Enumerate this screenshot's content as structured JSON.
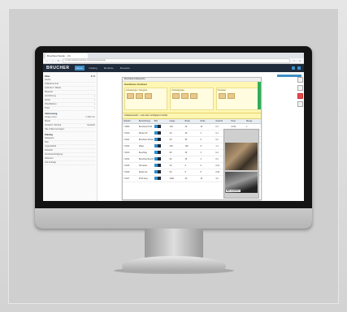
{
  "browser": {
    "tab_title": "Bruchfest Studio · Ch",
    "url": "⊕ http://www.bruchfest.ch/service/startseite"
  },
  "app": {
    "logo": "BRUCHER",
    "menu": [
      "Home",
      "Katalog",
      "Merkliste",
      "Bestellen"
    ],
    "active_menu": 0
  },
  "sidebar": {
    "sections": [
      {
        "title": "Filter",
        "count": "3 / 5",
        "items": [
          {
            "label": "Suche",
            "value": ""
          },
          {
            "label": "Artikelnummer",
            "value": ""
          },
          {
            "label": "Lieferant / Marke",
            "value": ""
          },
          {
            "label": "Material",
            "value": ""
          },
          {
            "label": "Ausführung",
            "value": "›"
          },
          {
            "label": "Farbe",
            "value": "›"
          },
          {
            "label": "Oberflächen",
            "value": "›"
          },
          {
            "label": "Preis",
            "value": "›"
          }
        ]
      },
      {
        "title": "Abmessung",
        "count": "",
        "items": [
          {
            "label": "Länge (mm)",
            "value": "≥ 100 mm"
          },
          {
            "label": "Breite",
            "value": ""
          },
          {
            "label": "Gewicht / Einheit",
            "value": "Gewicht"
          },
          {
            "label": "Alle Artikel anzeigen",
            "value": ""
          }
        ]
      },
      {
        "title": "Katalog",
        "count": "",
        "items": [
          {
            "label": "Kategorie",
            "value": ""
          },
          {
            "label": "Neu",
            "value": ""
          },
          {
            "label": "Lagerartikel",
            "value": ""
          },
          {
            "label": "Zubehör",
            "value": ""
          },
          {
            "label": "Sonderanfertigung",
            "value": ""
          },
          {
            "label": "Aktionen",
            "value": ""
          },
          {
            "label": "Auf Anfrage",
            "value": ""
          }
        ]
      }
    ]
  },
  "panel": {
    "title": "Bruchfest Artikelsuche",
    "top_banner": "Bruchfestes Sortiment",
    "columns": [
      {
        "title": "Artikelgruppe / Kategorie",
        "items": [
          "Profile",
          "Beschläge",
          "Platten"
        ]
      },
      {
        "title": "Produktgruppe",
        "items": [
          "Schrauben",
          "Dübel",
          "Winkel"
        ]
      },
      {
        "title": "Hersteller",
        "items": [
          "Marke A",
          "Marke B"
        ]
      }
    ],
    "filter_banner": "Artikelauswahl – Liste aller verfügbaren Artikel"
  },
  "table": {
    "headers": [
      "Artikelnr.",
      "Bezeichnung",
      "Bild",
      "Länge",
      "Breite",
      "Dicke",
      "Gewicht",
      "Preis",
      "Menge"
    ],
    "rows": [
      [
        "7.0009",
        "Bruchfest Profil",
        "",
        "100",
        "20",
        "10",
        "0.3",
        "12.50",
        "1"
      ],
      [
        "7.0010",
        "Winkel 40",
        "",
        "40",
        "40",
        "4",
        "0.1",
        "3.20",
        "1"
      ],
      [
        "7.0011",
        "Bruchfest Winkel",
        "",
        "60",
        "60",
        "5",
        "0.2",
        "4.80",
        "1"
      ],
      [
        "7.0012",
        "Platte",
        "",
        "200",
        "100",
        "8",
        "1.1",
        "22.00",
        "1"
      ],
      [
        "7.0013",
        "Beschlag",
        "",
        "80",
        "30",
        "3",
        "0.2",
        "6.90",
        "1"
      ],
      [
        "7.0014",
        "Bruchfest Beschlag",
        "",
        "90",
        "35",
        "3",
        "0.2",
        "7.40",
        "1"
      ],
      [
        "7.0015",
        "Schraube",
        "",
        "30",
        "6",
        "6",
        "0.01",
        "0.40",
        "1"
      ],
      [
        "7.0016",
        "Dübel Set",
        "",
        "50",
        "8",
        "8",
        "0.05",
        "2.10",
        "1"
      ],
      [
        "7.0017",
        "Profil lang",
        "",
        "2000",
        "20",
        "10",
        "3.0",
        "48.00",
        "1"
      ]
    ]
  },
  "preview": {
    "caption": "Bild vergrößern"
  },
  "colors": {
    "header_bg": "#1f2a3a",
    "accent": "#3e8ec7",
    "banner_yellow": "#fff6b3",
    "green_tab": "#2fae55",
    "danger": "#e04a4a"
  }
}
